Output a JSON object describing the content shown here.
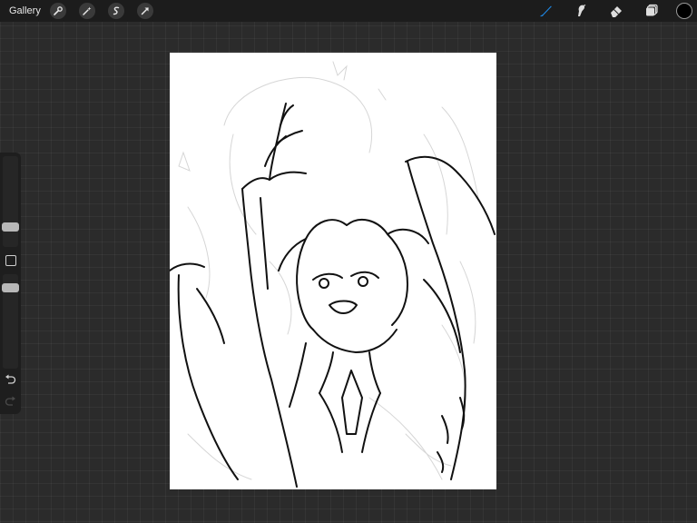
{
  "topbar": {
    "gallery_label": "Gallery",
    "left_tools": [
      "wrench-icon",
      "magic-wand-icon",
      "selection-icon",
      "transform-arrow-icon"
    ],
    "right_tools": [
      "brush-icon",
      "smudge-icon",
      "eraser-icon",
      "layers-icon"
    ],
    "active_tool": "brush-icon",
    "current_color": "#000000",
    "accent_color": "#1e88e5"
  },
  "sidebar": {
    "brush_size_level": 0.35,
    "opacity_level": 0.8,
    "undo_icon": "undo-icon",
    "redo_icon": "redo-icon"
  },
  "canvas": {
    "background": "#ffffff",
    "content": "sketch-drawing"
  }
}
